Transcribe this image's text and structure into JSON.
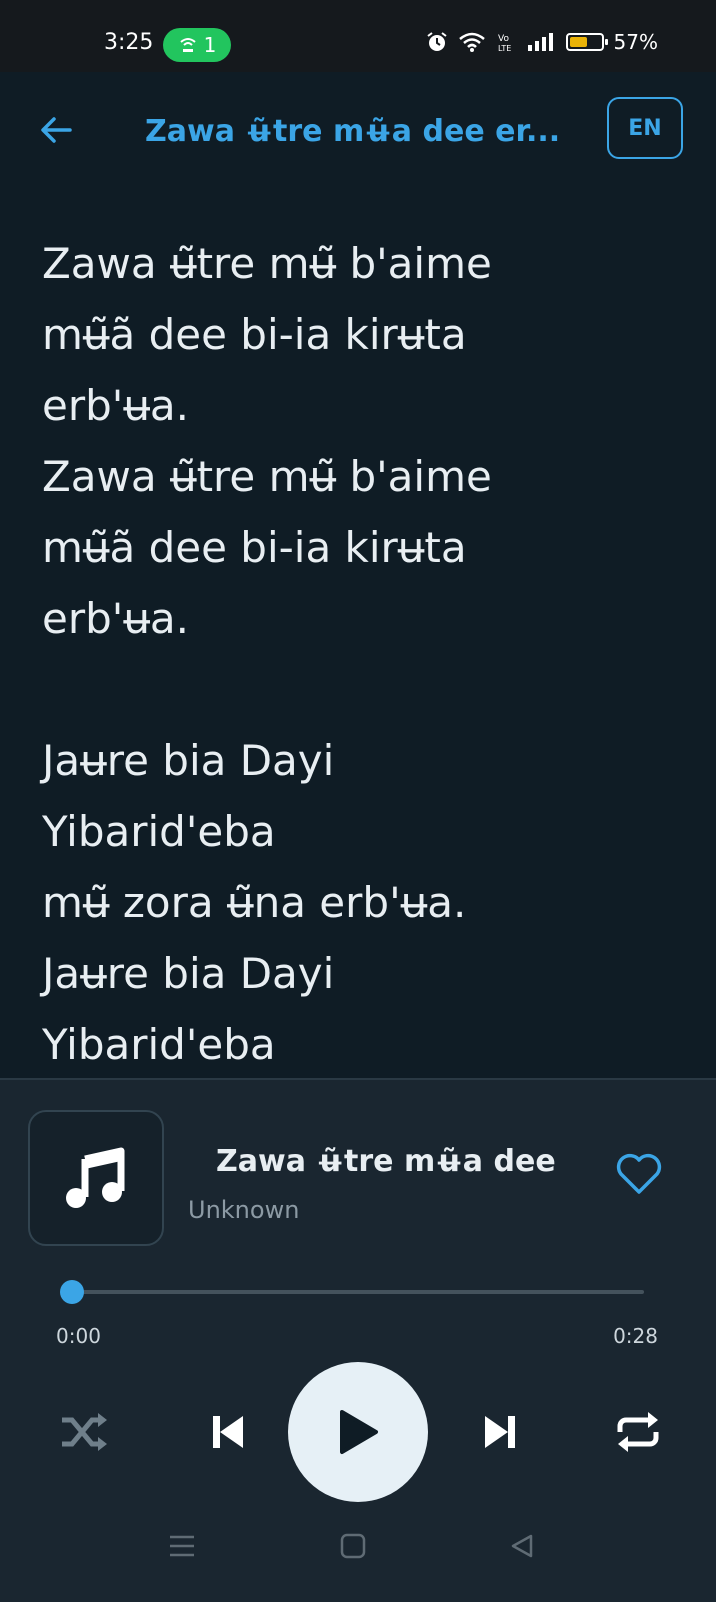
{
  "status_bar": {
    "time": "3:25",
    "hotspot_count": "1",
    "battery_percent": "57%",
    "battery_level": 0.57,
    "icons": [
      "alarm-icon",
      "wifi-icon",
      "volte-icon",
      "signal-icon",
      "battery-icon"
    ]
  },
  "appbar": {
    "title": "Zawa ʉ̃tre mʉ̃a dee er...",
    "language_button": "EN"
  },
  "lyrics": [
    "Zawa ʉ̃tre mʉ̃ b'aime",
    "mʉ̃ã dee bi-ia kirʉta",
    "erb'ʉa.",
    "Zawa ʉ̃tre mʉ̃ b'aime",
    "mʉ̃ã dee bi-ia kirʉta",
    "erb'ʉa.",
    "",
    "Jaʉre bia Dayi",
    "Yibarid'eba",
    "mʉ̃ zora ʉ̃na erb'ʉa.",
    "Jaʉre bia Dayi",
    "Yibarid'eba"
  ],
  "player": {
    "song_title": "Zawa ʉ̃tre mʉ̃a dee",
    "artist": "Unknown",
    "current_time": "0:00",
    "duration": "0:28",
    "progress": 0.0,
    "accent_color": "#3ba5e6"
  },
  "controls": {
    "shuffle": "shuffle-icon",
    "previous": "skip-previous-icon",
    "play": "play-icon",
    "next": "skip-next-icon",
    "repeat": "repeat-icon"
  },
  "navigation": [
    "menu-icon",
    "home-icon",
    "back-icon"
  ]
}
